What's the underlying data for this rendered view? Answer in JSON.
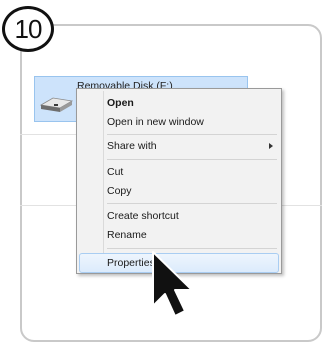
{
  "step": {
    "number": "10"
  },
  "explorer": {
    "drive_label": "Removable Disk (F:)",
    "drive_icon": "removable-drive-icon"
  },
  "context_menu": {
    "open": "Open",
    "open_new_window": "Open in new window",
    "share_with": "Share with",
    "cut": "Cut",
    "copy": "Copy",
    "create_shortcut": "Create shortcut",
    "rename": "Rename",
    "properties": "Properties",
    "highlighted_item": "Properties"
  },
  "colors": {
    "selection": "#cde3fb",
    "menu_background": "#f2f2f2",
    "hover": "#dcebfc"
  },
  "cursor": {
    "icon": "mouse-pointer-icon"
  }
}
